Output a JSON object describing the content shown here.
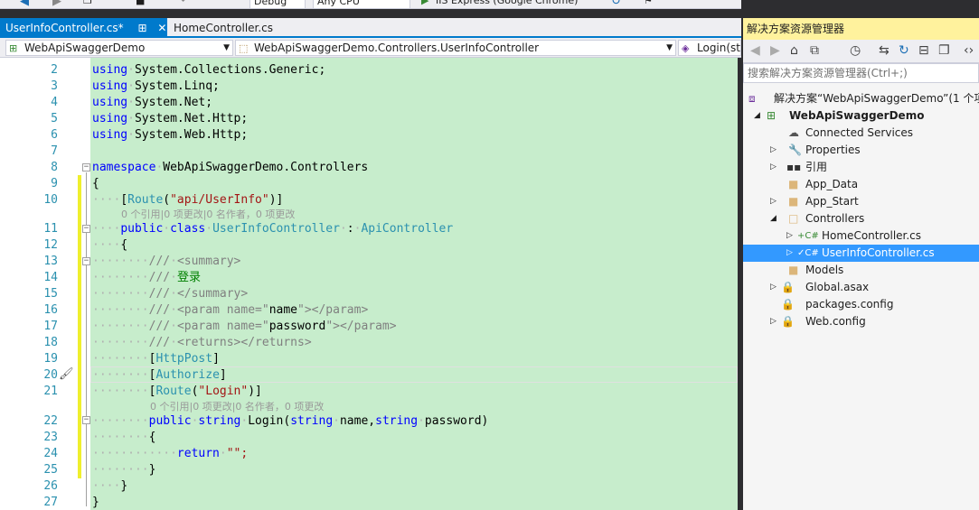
{
  "toolbar": {
    "config": "Debug",
    "platform": "Any CPU",
    "run_target": "IIS Express (Google Chrome)"
  },
  "tabs": [
    {
      "label": "UserInfoController.cs*",
      "close": "✕",
      "pin": "⊞",
      "active": true
    },
    {
      "label": "HomeController.cs",
      "active": false
    }
  ],
  "navbar": {
    "project": "WebApiSwaggerDemo",
    "type": "WebApiSwaggerDemo.Controllers.UserInfoController",
    "member": "Login(str"
  },
  "editor": {
    "line_numbers": [
      "2",
      "3",
      "4",
      "5",
      "6",
      "7",
      "8",
      "9",
      "10",
      "11",
      "12",
      "13",
      "14",
      "15",
      "16",
      "17",
      "18",
      "19",
      "20",
      "21",
      "22",
      "23",
      "24",
      "25",
      "26",
      "27"
    ],
    "lines": {
      "l2": [
        "using",
        "System.Collections.Generic;"
      ],
      "l3": [
        "using",
        "System.Linq;"
      ],
      "l4": [
        "using",
        "System.Net;"
      ],
      "l5": [
        "using",
        "System.Net.Http;"
      ],
      "l6": [
        "using",
        "System.Web.Http;"
      ],
      "l8": [
        "namespace",
        "WebApiSwaggerDemo.Controllers"
      ],
      "l9": "{",
      "l10": [
        "[",
        "Route",
        "(",
        "\"api/UserInfo\"",
        ")]"
      ],
      "lens1": "0 个引用|0 项更改|0 名作者，0 项更改",
      "l11": [
        "public",
        "class",
        "UserInfoController",
        ":",
        "ApiController"
      ],
      "l12": "{",
      "l13": [
        "///",
        "<summary>"
      ],
      "l14": [
        "///",
        "登录"
      ],
      "l15": [
        "///",
        "</summary>"
      ],
      "l16": [
        "///",
        "<param name=\"",
        "name",
        "\"></param>"
      ],
      "l17": [
        "///",
        "<param name=\"",
        "password",
        "\"></param>"
      ],
      "l18": [
        "///",
        "<returns></returns>"
      ],
      "l19": [
        "[",
        "HttpPost",
        "]"
      ],
      "l20": [
        "[",
        "Authorize",
        "]"
      ],
      "l21": [
        "[",
        "Route",
        "(",
        "\"Login\"",
        ")]"
      ],
      "lens2": "0 个引用|0 项更改|0 名作者，0 项更改",
      "l22": [
        "public",
        "string",
        "Login(",
        "string",
        "name,",
        "string",
        "password)"
      ],
      "l23": "{",
      "l24": [
        "return",
        "\"\";"
      ],
      "l25": "}",
      "l26": "}",
      "l27": "}"
    }
  },
  "solution_explorer": {
    "title": "解决方案资源管理器",
    "search_placeholder": "搜索解决方案资源管理器(Ctrl+;)",
    "items": [
      {
        "label": "解决方案“WebApiSwaggerDemo”(1 个项",
        "icon": "solution-icon"
      },
      {
        "label": "WebApiSwaggerDemo",
        "icon": "project-icon"
      },
      {
        "label": "Connected Services",
        "icon": "cloud-icon"
      },
      {
        "label": "Properties",
        "icon": "wrench-icon"
      },
      {
        "label": "引用",
        "icon": "references-icon"
      },
      {
        "label": "App_Data",
        "icon": "folder-icon"
      },
      {
        "label": "App_Start",
        "icon": "folder-icon"
      },
      {
        "label": "Controllers",
        "icon": "folder-open-icon"
      },
      {
        "label": "HomeController.cs",
        "icon": "csharp-file-icon"
      },
      {
        "label": "UserInfoController.cs",
        "icon": "csharp-file-icon"
      },
      {
        "label": "Models",
        "icon": "folder-icon"
      },
      {
        "label": "Global.asax",
        "icon": "file-icon"
      },
      {
        "label": "packages.config",
        "icon": "file-icon"
      },
      {
        "label": "Web.config",
        "icon": "file-icon"
      }
    ]
  },
  "colors": {
    "accent": "#007acc",
    "selection": "#3399ff",
    "code_background": "#c7edcc",
    "change_marker": "#efef2d",
    "keyword": "#0000ff",
    "type": "#2b91af",
    "string": "#a31515"
  }
}
